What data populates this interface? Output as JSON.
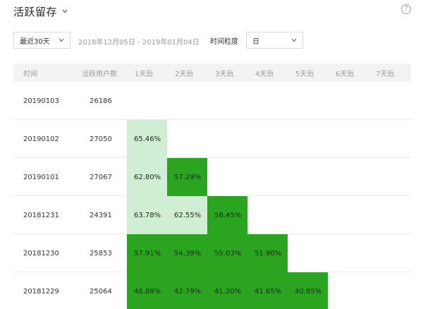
{
  "header": {
    "title": "活跃留存",
    "help_icon": "?"
  },
  "filters": {
    "period_select": "最近30天",
    "date_range": "2018年12月05日 - 2019年01月04日",
    "granularity_label": "时间粒度",
    "granularity_select": "日"
  },
  "colors": {
    "light": "#cfeed4",
    "dark": "#2ba520",
    "header_bg": "#f3f3f5",
    "grid": "#e9e9e9"
  },
  "table": {
    "columns": [
      "时间",
      "活跃用户数",
      "1天后",
      "2天后",
      "3天后",
      "4天后",
      "5天后",
      "6天后",
      "7天后"
    ],
    "rows": [
      {
        "date": "20190103",
        "users": "26186",
        "cells": []
      },
      {
        "date": "20190102",
        "users": "27050",
        "cells": [
          {
            "value": "65.46%",
            "level": "light"
          }
        ]
      },
      {
        "date": "20190101",
        "users": "27067",
        "cells": [
          {
            "value": "62.80%",
            "level": "light"
          },
          {
            "value": "57.29%",
            "level": "dark"
          }
        ]
      },
      {
        "date": "20181231",
        "users": "24391",
        "cells": [
          {
            "value": "63.78%",
            "level": "light"
          },
          {
            "value": "62.55%",
            "level": "light"
          },
          {
            "value": "58.45%",
            "level": "dark"
          }
        ]
      },
      {
        "date": "20181230",
        "users": "25853",
        "cells": [
          {
            "value": "57.91%",
            "level": "dark"
          },
          {
            "value": "54.39%",
            "level": "dark"
          },
          {
            "value": "55.03%",
            "level": "dark"
          },
          {
            "value": "51.90%",
            "level": "dark"
          }
        ]
      },
      {
        "date": "20181229",
        "users": "25064",
        "cells": [
          {
            "value": "46.88%",
            "level": "dark"
          },
          {
            "value": "42.79%",
            "level": "dark"
          },
          {
            "value": "41.20%",
            "level": "dark"
          },
          {
            "value": "41.65%",
            "level": "dark"
          },
          {
            "value": "40.85%",
            "level": "dark"
          }
        ]
      }
    ]
  }
}
